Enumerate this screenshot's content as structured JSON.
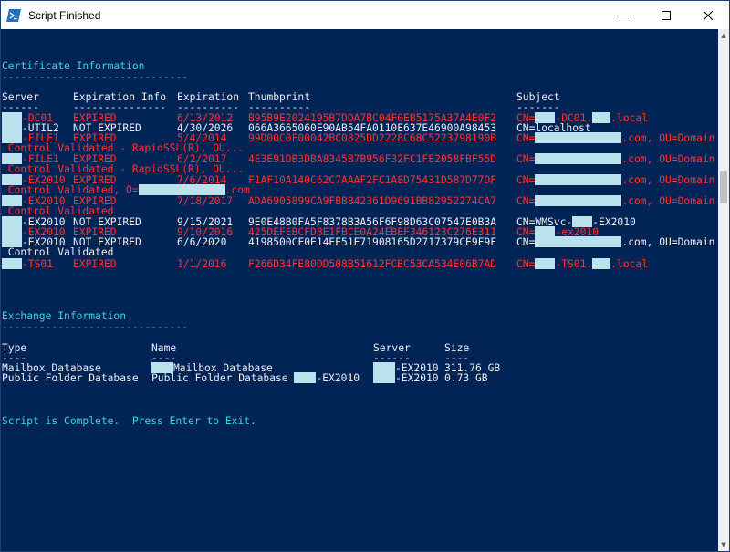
{
  "window": {
    "title": "Script Finished"
  },
  "cert": {
    "heading": "Certificate Information",
    "dash": "------------------------------",
    "headers": {
      "server": "Server",
      "info": "Expiration Info",
      "exp": "Expiration",
      "thumb": "Thumbprint",
      "subject": "Subject"
    },
    "underline": {
      "server": "------",
      "info": "---------------",
      "exp": "----------",
      "thumb": "----------",
      "subject": "-------"
    },
    "rows": [
      {
        "server": "-DC01",
        "info": "EXPIRED",
        "exp": "6/13/2012",
        "thumb": "B95B9E2024195B7DDA7BC04F0EB5175A37A4E0F2",
        "subject_a": "CN=",
        "subject_b": "-DC01.",
        "subject_c": ".local",
        "color": "red"
      },
      {
        "server": "-UTIL2",
        "info": "NOT EXPIRED",
        "exp": "4/30/2026",
        "thumb": "066A3665060E90AB54FA0110E637E46900A98453",
        "subject_a": "CN=localhost",
        "color": "white"
      },
      {
        "server": "-FILE1",
        "info": "EXPIRED",
        "exp": "5/4/2014",
        "thumb": "99D00C0F00042BC0825DD2228C68C5223798190B",
        "subject_a": "CN=",
        "subject_c": ".com, OU=Domain",
        "color": "red"
      },
      {
        "server": "-FILE1",
        "info": "EXPIRED",
        "exp": "6/2/2017",
        "thumb": "4E3E91DB3DBA8345B7B956F32FC1FE2058FBF55D",
        "subject_a": "CN=",
        "subject_c": ".com, OU=Domain",
        "color": "red"
      },
      {
        "server": "-EX2010",
        "info": "EXPIRED",
        "exp": "7/6/2014",
        "thumb": "F1AF10A140C62C7AAAF2FC1A8D75431D587D77DF",
        "subject_a": "CN=",
        "subject_c": ".com, OU=Domain",
        "color": "red"
      },
      {
        "server": "-EX2010",
        "info": "EXPIRED",
        "exp": "7/18/2017",
        "thumb": "ADA6905899CA9FBB842361D9691BB82952274CA7",
        "subject_a": "CN=",
        "subject_c": ".com, OU=Domain",
        "color": "red"
      },
      {
        "server": "-EX2010",
        "info": "NOT EXPIRED",
        "exp": "9/15/2021",
        "thumb": "9E0E48B0FA5F8378B3A56F6F98D63C07547E0B3A",
        "subject_a": "CN=WMSvc-",
        "subject_c": "-EX2010",
        "color": "white"
      },
      {
        "server": "-EX2010",
        "info": "EXPIRED",
        "exp": "9/10/2016",
        "thumb": "425DEFEBCFD8E1FBCE0A24EBEF346123C276E311",
        "subject_a": "CN=",
        "subject_c": "-ex2010",
        "color": "red"
      },
      {
        "server": "-EX2010",
        "info": "NOT EXPIRED",
        "exp": "6/6/2020",
        "thumb": "4198500CF0E14EE51E71908165D2717379CE9F9F",
        "subject_a": "CN=",
        "subject_c": ".com, OU=Domain",
        "color": "white"
      },
      {
        "server": "-TS01",
        "info": "EXPIRED",
        "exp": "1/1/2016",
        "thumb": "F266D34FE80DD508B51612FCBC53CA534E06B7AD",
        "subject_a": "CN=",
        "subject_b": "-TS01.",
        "subject_c": ".local",
        "color": "red"
      }
    ],
    "cont_rapid": " Control Validated - RapidSSL(R), OU...",
    "cont_validated": " Control Validated",
    "cont_o": " Control Validated, O=",
    "cont_o_tail": ".com"
  },
  "exchange": {
    "heading": "Exchange Information",
    "dash": "------------------------------",
    "headers": {
      "type": "Type",
      "name": "Name",
      "server": "Server",
      "size": "Size"
    },
    "underline": {
      "type": "----",
      "name": "----",
      "server": "------",
      "size": "----"
    },
    "rows": [
      {
        "type": "Mailbox Database",
        "name": "Mailbox Database",
        "server": "-EX2010",
        "size": "311.76 GB"
      },
      {
        "type": "Public Folder Database",
        "name": "Public Folder Database ",
        "name_tail": "-EX2010",
        "server": "-EX2010",
        "size": "0.73 GB"
      }
    ]
  },
  "footer": {
    "message": "Script is Complete.  Press Enter to Exit."
  },
  "colors": {
    "background": "#012456",
    "cyan": "#3ad3e0",
    "red": "#ff3030",
    "text": "#eeedf0",
    "redaction": "#b9e2ed"
  },
  "icons": [
    "powershell-icon",
    "minimize-icon",
    "maximize-icon",
    "close-icon"
  ]
}
